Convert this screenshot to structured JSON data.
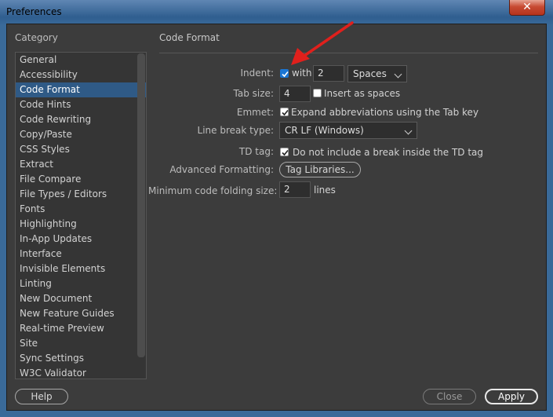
{
  "window": {
    "title": "Preferences",
    "close_icon": "close-icon"
  },
  "category": {
    "heading": "Category",
    "selected_index": 2,
    "items": [
      "General",
      "Accessibility",
      "Code Format",
      "Code Hints",
      "Code Rewriting",
      "Copy/Paste",
      "CSS Styles",
      "Extract",
      "File Compare",
      "File Types / Editors",
      "Fonts",
      "Highlighting",
      "In-App Updates",
      "Interface",
      "Invisible Elements",
      "Linting",
      "New Document",
      "New Feature Guides",
      "Real-time Preview",
      "Site",
      "Sync Settings",
      "W3C Validator"
    ]
  },
  "panel": {
    "title": "Code Format",
    "indent": {
      "label": "Indent:",
      "checked": true,
      "with_label": "with",
      "value": "2",
      "unit": "Spaces"
    },
    "tab_size": {
      "label": "Tab size:",
      "value": "4",
      "insert_spaces_label": "Insert as spaces",
      "insert_spaces_checked": false
    },
    "emmet": {
      "label": "Emmet:",
      "checked": true,
      "text": "Expand abbreviations using the Tab key"
    },
    "line_break": {
      "label": "Line break type:",
      "value": "CR LF (Windows)"
    },
    "td_tag": {
      "label": "TD tag:",
      "checked": true,
      "text": "Do not include a break inside the TD tag"
    },
    "advanced": {
      "label": "Advanced Formatting:",
      "button": "Tag Libraries..."
    },
    "folding": {
      "label": "Minimum code folding size:",
      "value": "2",
      "unit": "lines"
    }
  },
  "footer": {
    "help": "Help",
    "close": "Close",
    "apply": "Apply"
  },
  "annotation": {
    "arrow_color": "#e0201c"
  }
}
